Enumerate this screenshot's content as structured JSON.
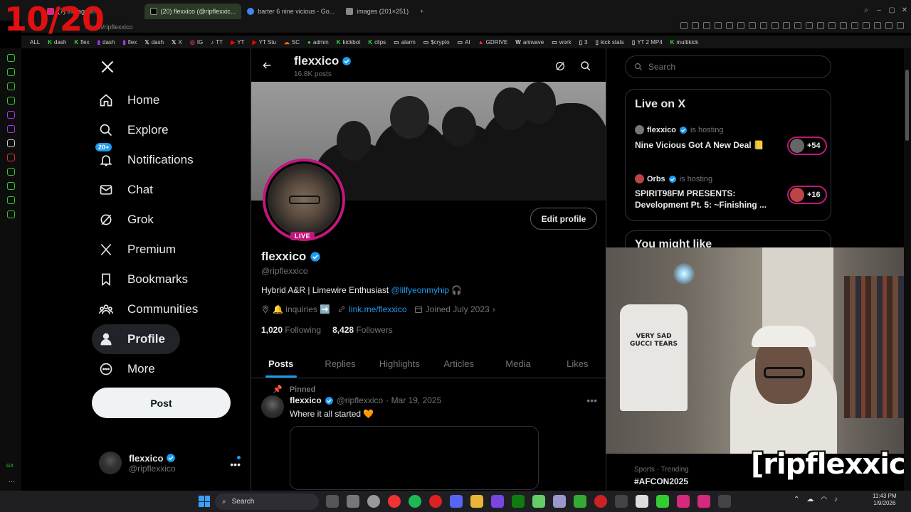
{
  "overlay": {
    "counter": "10/20",
    "watermark": "[ripflexxico]"
  },
  "browser": {
    "tabs": [
      {
        "label": "(7) Instagram",
        "color": "#d6297d"
      },
      {
        "label": "(20) flexxico (@ripflexxic...",
        "color": "#000000"
      },
      {
        "label": "barter 6 nine vicious - Go...",
        "color": "#4285f4"
      },
      {
        "label": "images (201×251)",
        "color": "#888888"
      }
    ],
    "address": "x.com/ripflexxico",
    "bookmarks": [
      "ALL",
      "dash",
      "flex",
      "dash",
      "flex",
      "dash",
      "X",
      "IG",
      "TT",
      "YT",
      "YT Stu",
      "SC",
      "admin",
      "kickbot",
      "clips",
      "alarm",
      "$crypto",
      "AI",
      "GDRIVE",
      "aniwave",
      "work",
      "3",
      "kick stats",
      "YT 2 MP4",
      "multikick"
    ]
  },
  "nav": {
    "items": [
      {
        "label": "Home",
        "icon": "home-icon"
      },
      {
        "label": "Explore",
        "icon": "search-icon"
      },
      {
        "label": "Notifications",
        "icon": "bell-icon",
        "badge": "20+"
      },
      {
        "label": "Chat",
        "icon": "mail-icon"
      },
      {
        "label": "Grok",
        "icon": "grok-icon"
      },
      {
        "label": "Premium",
        "icon": "x-icon"
      },
      {
        "label": "Bookmarks",
        "icon": "bookmark-icon"
      },
      {
        "label": "Communities",
        "icon": "communities-icon"
      },
      {
        "label": "Profile",
        "icon": "person-icon"
      },
      {
        "label": "More",
        "icon": "more-icon"
      }
    ],
    "post_label": "Post",
    "account": {
      "name": "flexxico",
      "handle": "@ripflexxico"
    }
  },
  "header": {
    "name": "flexxico",
    "posts": "16.8K posts"
  },
  "profile": {
    "name": "flexxico",
    "handle": "@ripflexxico",
    "live_label": "LIVE",
    "edit_label": "Edit profile",
    "bio_text": "Hybrid A&R | Limewire Enthusiast ",
    "bio_mention": "@lilfyeonmyhip",
    "bio_tail": " 🎧",
    "location": "🔔 inquiries ➡️",
    "link": "link.me/flexxico",
    "joined": "Joined July 2023",
    "following_count": "1,020",
    "following_label": "Following",
    "followers_count": "8,428",
    "followers_label": "Followers",
    "tabs": [
      "Posts",
      "Replies",
      "Highlights",
      "Articles",
      "Media",
      "Likes"
    ]
  },
  "pinned_tweet": {
    "pinned_label": "Pinned",
    "name": "flexxico",
    "handle": "@ripflexxico",
    "date": "· Mar 19, 2025",
    "text": "Where it all started 🧡"
  },
  "right": {
    "search_placeholder": "Search",
    "live_title": "Live on X",
    "lives": [
      {
        "host": "flexxico",
        "hosting": "is hosting",
        "title": "Nine Vicious Got A New Deal 📒",
        "count": "+54"
      },
      {
        "host": "Orbs",
        "hosting": "is hosting",
        "title": "SPIRIT98FM PRESENTS: Development Pt. 5: ~Finishing ...",
        "count": "+16"
      }
    ],
    "might_like": "You might like",
    "trend": {
      "label": "Sports · Trending",
      "tag": "#AFCON2025"
    }
  },
  "webcam": {
    "shirt_text": "VERY SAD GUCCI TEARS"
  },
  "taskbar": {
    "search": "Search",
    "time": "11:43 PM",
    "date": "1/9/2026"
  }
}
